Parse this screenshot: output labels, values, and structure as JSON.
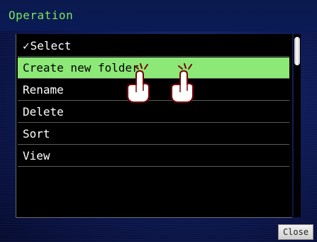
{
  "header": {
    "title": "Operation"
  },
  "menu": {
    "items": [
      {
        "label": "Select",
        "checked": true,
        "selected": false
      },
      {
        "label": "Create new folder",
        "checked": false,
        "selected": true
      },
      {
        "label": "Rename",
        "checked": false,
        "selected": false
      },
      {
        "label": "Delete",
        "checked": false,
        "selected": false
      },
      {
        "label": "Sort",
        "checked": false,
        "selected": false
      },
      {
        "label": "View",
        "checked": false,
        "selected": false
      }
    ],
    "check_glyph": "✓"
  },
  "footer": {
    "close_label": "Close"
  },
  "colors": {
    "title_text": "#7fe85a",
    "selected_row": "#8ce877",
    "background": "#0d1a55"
  },
  "icons": {
    "tap_gesture": "double-tap-hand-icon"
  }
}
